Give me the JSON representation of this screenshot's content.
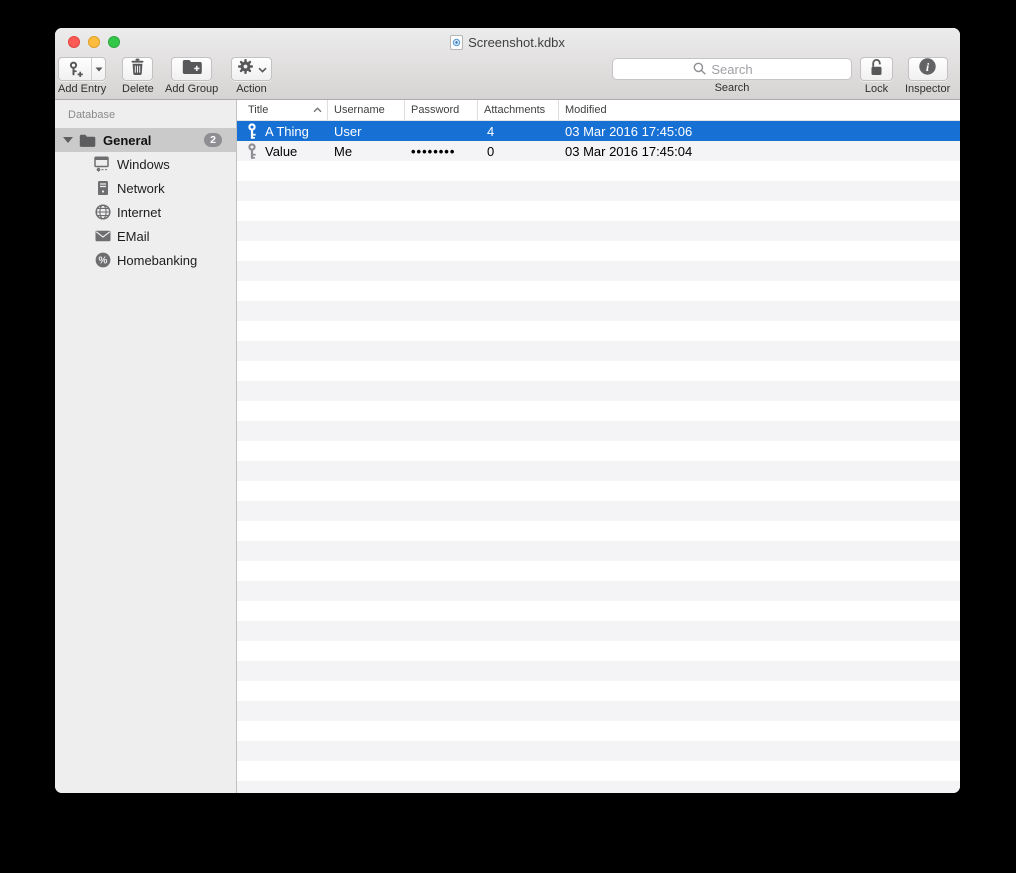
{
  "window": {
    "title": "Screenshot.kdbx"
  },
  "toolbar": {
    "add_entry_label": "Add Entry",
    "delete_label": "Delete",
    "add_group_label": "Add Group",
    "action_label": "Action",
    "search_label": "Search",
    "search_placeholder": "Search",
    "search_value": "",
    "lock_label": "Lock",
    "inspector_label": "Inspector"
  },
  "sidebar": {
    "section_header": "Database",
    "root": {
      "label": "General",
      "badge": "2",
      "icon": "folder-icon",
      "expanded": true
    },
    "items": [
      {
        "label": "Windows",
        "icon": "windows-icon"
      },
      {
        "label": "Network",
        "icon": "network-icon"
      },
      {
        "label": "Internet",
        "icon": "internet-icon"
      },
      {
        "label": "EMail",
        "icon": "email-icon"
      },
      {
        "label": "Homebanking",
        "icon": "homebanking-icon"
      }
    ]
  },
  "table": {
    "columns": [
      "Title",
      "Username",
      "Password",
      "Attachments",
      "Modified"
    ],
    "sort": {
      "column": "Title",
      "direction": "ascending"
    },
    "rows": [
      {
        "icon": "key-icon",
        "title": "A Thing",
        "username": "User",
        "password": "",
        "attachments": "4",
        "modified": "03 Mar 2016 17:45:06",
        "selected": true
      },
      {
        "icon": "key-icon",
        "title": "Value",
        "username": "Me",
        "password": "••••••••",
        "attachments": "0",
        "modified": "03 Mar 2016 17:45:04",
        "selected": false
      }
    ]
  },
  "colors": {
    "selection_blue": "#1770d4",
    "row_stripe": "#f4f4f6",
    "sidebar_selection": "#cacaca",
    "badge_gray": "#8e8e93"
  }
}
